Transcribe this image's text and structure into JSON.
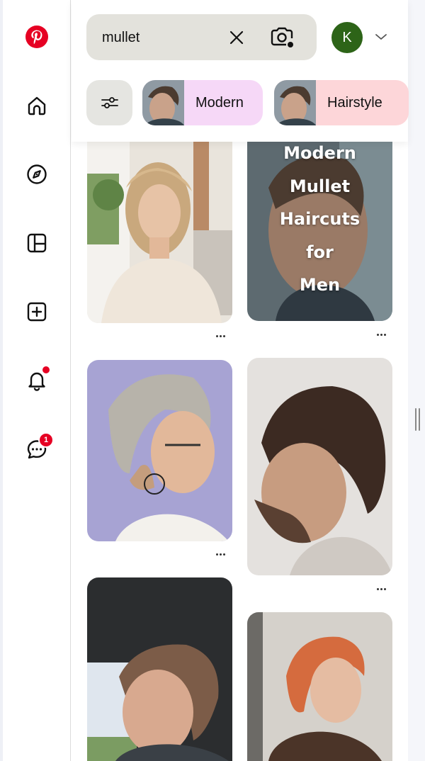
{
  "search": {
    "query": "mullet",
    "clear_icon": "close-icon",
    "camera_icon": "camera-search-icon"
  },
  "account": {
    "initial": "K",
    "color": "#2d6418"
  },
  "filters": {
    "icon": "sliders-icon",
    "chips": [
      {
        "label": "Modern",
        "color": "#f6d8f7"
      },
      {
        "label": "Hairstyle",
        "color": "#fdd6d9"
      }
    ]
  },
  "nav": {
    "items": [
      "pinterest-logo",
      "home-icon",
      "explore-icon",
      "boards-icon",
      "create-icon",
      "notifications-icon",
      "messages-icon"
    ],
    "notification_dot": true,
    "message_count": "1",
    "brand_color": "#e60023"
  },
  "pins": [
    {
      "name": "pin-woman-shag-mullet"
    },
    {
      "name": "pin-modern-mullet-haircuts-men",
      "overlay_lines": [
        "Modern",
        "Mullet",
        "Haircuts",
        "for",
        "Men"
      ]
    },
    {
      "name": "pin-pixie-mullet-glasses"
    },
    {
      "name": "pin-curly-mullet-fade"
    },
    {
      "name": "pin-textured-mullet-car"
    },
    {
      "name": "pin-copper-mullet"
    }
  ]
}
